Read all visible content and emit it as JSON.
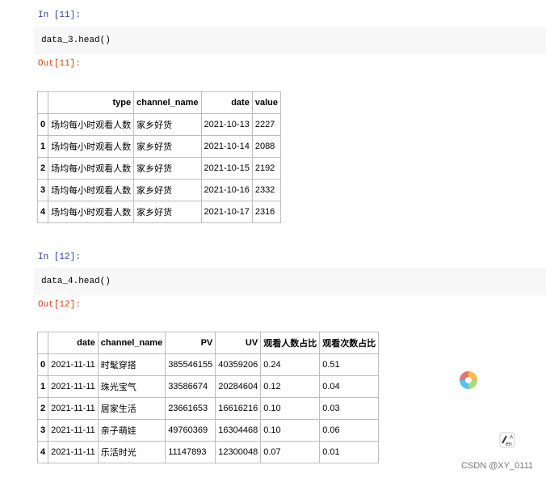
{
  "cell11": {
    "in_prompt": "In [11]:",
    "code": "data_3.head()",
    "out_prompt": "Out[11]:",
    "table": {
      "columns": [
        "",
        "type",
        "channel_name",
        "date",
        "value"
      ],
      "rows": [
        [
          "0",
          "场均每小时观看人数",
          "家乡好货",
          "2021-10-13",
          "2227"
        ],
        [
          "1",
          "场均每小时观看人数",
          "家乡好货",
          "2021-10-14",
          "2088"
        ],
        [
          "2",
          "场均每小时观看人数",
          "家乡好货",
          "2021-10-15",
          "2192"
        ],
        [
          "3",
          "场均每小时观看人数",
          "家乡好货",
          "2021-10-16",
          "2332"
        ],
        [
          "4",
          "场均每小时观看人数",
          "家乡好货",
          "2021-10-17",
          "2316"
        ]
      ]
    }
  },
  "cell12": {
    "in_prompt": "In [12]:",
    "code": "data_4.head()",
    "out_prompt": "Out[12]:",
    "table": {
      "columns": [
        "",
        "date",
        "channel_name",
        "PV",
        "UV",
        "观看人数占比",
        "观看次数占比"
      ],
      "rows": [
        [
          "0",
          "2021-11-11",
          "时髦穿搭",
          "385546155",
          "40359206",
          "0.24",
          "0.51"
        ],
        [
          "1",
          "2021-11-11",
          "珠光宝气",
          "33586674",
          "20284604",
          "0.12",
          "0.04"
        ],
        [
          "2",
          "2021-11-11",
          "居家生活",
          "23661653",
          "16616216",
          "0.10",
          "0.03"
        ],
        [
          "3",
          "2021-11-11",
          "亲子萌娃",
          "49760369",
          "16304468",
          "0.10",
          "0.06"
        ],
        [
          "4",
          "2021-11-11",
          "乐活时光",
          "11147893",
          "12300048",
          "0.07",
          "0.01"
        ]
      ]
    }
  },
  "watermark": "CSDN @XY_0111",
  "icons": {
    "floating_ball": "floating-ball-icon",
    "translate": "translate-icon"
  }
}
